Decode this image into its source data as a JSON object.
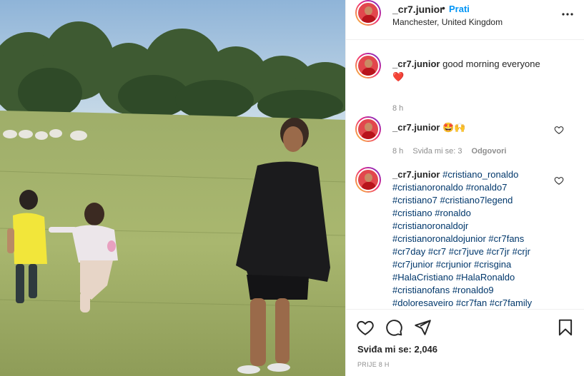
{
  "post_owner": {
    "username": "_cr7.junior",
    "separator": "•",
    "follow_label": "Prati",
    "location": "Manchester, United Kingdom"
  },
  "comments": [
    {
      "username": "_cr7.junior",
      "text": "good morning everyone",
      "emoji": "❤️",
      "time": "8 h"
    },
    {
      "username": "_cr7.junior",
      "text": "🤩🙌",
      "time": "8 h",
      "likes": "Sviđa mi se: 3",
      "reply_label": "Odgovori"
    },
    {
      "username": "_cr7.junior",
      "lines": [
        "#cristiano_ronaldo",
        "#cristianoronaldo #ronaldo7",
        "#cristiano7 #cristiano7legend",
        "#cristiano #ronaldo",
        "#cristianoronaldojr",
        "#cristianoronaldojunior #cr7fans",
        "#cr7day #cr7 #cr7juve #cr7jr #crjr",
        "#cr7junior #crjunior #crisgina",
        "#HalaCristiano #HalaRonaldo",
        "#cristianofans #ronaldo9",
        "#doloresaveiro #cr7fan #cr7family"
      ]
    }
  ],
  "actions": {
    "like_icon": "heart-icon",
    "comment_icon": "comment-icon",
    "share_icon": "paper-plane-icon",
    "save_icon": "bookmark-icon"
  },
  "likes_count": "Sviđa mi se: 2,046",
  "posted_ago": "PRIJE 8 H",
  "colors": {
    "link": "#0095f6",
    "hashtag": "#00376b",
    "muted": "#8e8e8e",
    "heart": "#ed4956"
  }
}
